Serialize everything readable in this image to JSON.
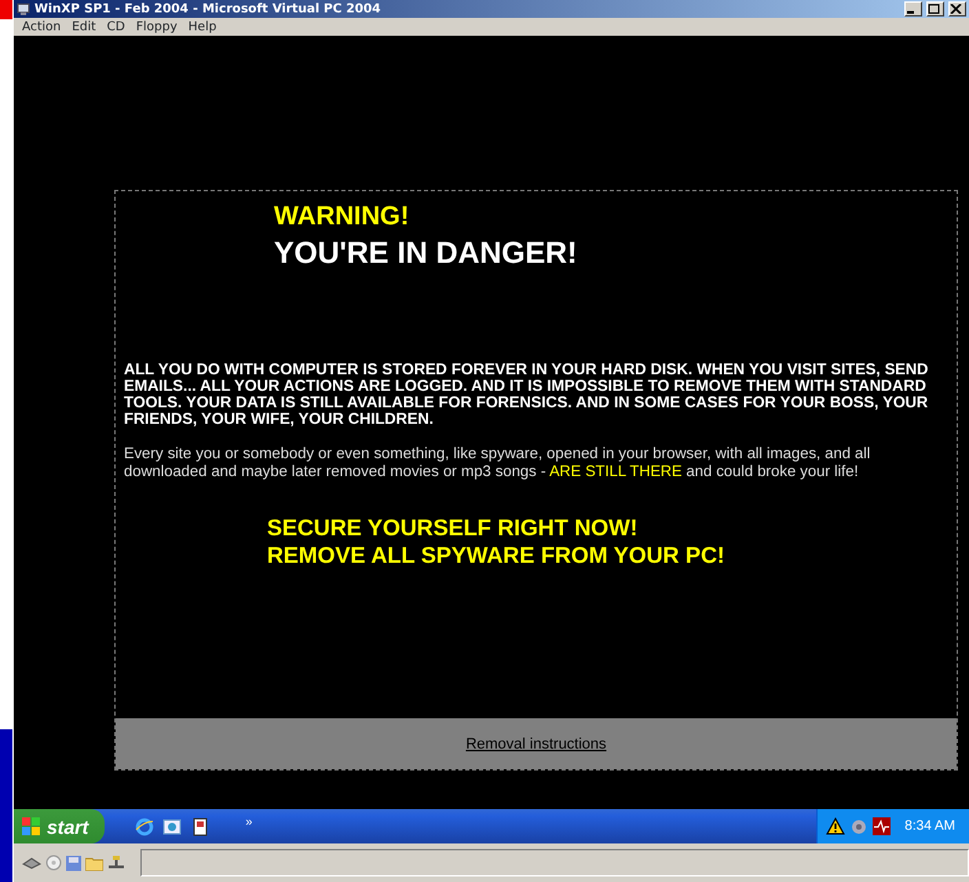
{
  "window": {
    "title": "WinXP SP1 - Feb 2004 - Microsoft Virtual PC 2004"
  },
  "menu": [
    "Action",
    "Edit",
    "CD",
    "Floppy",
    "Help"
  ],
  "page": {
    "heading": "WARNING!",
    "subheading": "YOU'RE IN DANGER!",
    "notice": "ALL YOU DO WITH COMPUTER IS STORED FOREVER IN YOUR HARD DISK. WHEN YOU VISIT SITES, SEND EMAILS... ALL YOUR ACTIONS ARE LOGGED. AND IT IS IMPOSSIBLE TO REMOVE THEM WITH STANDARD TOOLS. YOUR DATA IS STILL AVAILABLE FOR FORENSICS. AND IN SOME CASES FOR YOUR BOSS, YOUR FRIENDS, YOUR WIFE, YOUR CHILDREN.",
    "detail": [
      {
        "text": "Every site you or somebody or even something, like spyware, opened in your browser, with all images, and all downloaded and maybe later removed movies or mp3 songs - ",
        "highlight": false
      },
      {
        "text": "ARE STILL THERE",
        "highlight": true
      },
      {
        "text": " and could broke your life!",
        "highlight": false
      }
    ],
    "call_to_action": [
      "SECURE YOURSELF RIGHT NOW!",
      "REMOVE ALL SPYWARE FROM YOUR PC!"
    ],
    "link": "Removal instructions"
  },
  "taskbar": {
    "start": "start",
    "quick_launch": [
      {
        "kind": "browser"
      },
      {
        "kind": "mail"
      },
      {
        "kind": "document"
      }
    ],
    "more": "»",
    "clock": "8:34 AM"
  }
}
